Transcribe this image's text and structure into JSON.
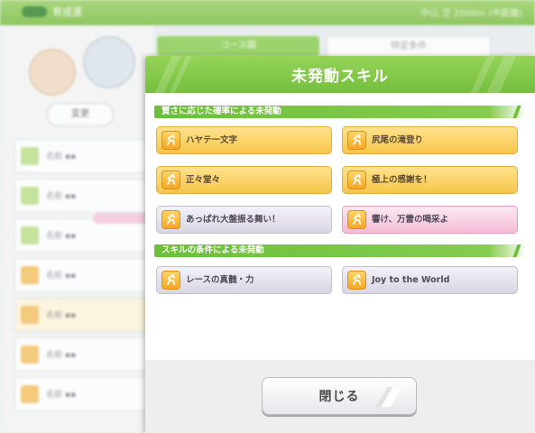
{
  "background": {
    "topbar_title": "育成選",
    "topbar_right": "中山 芝 2000m (中距離)",
    "tab_left": "コース図",
    "tab_right": "特定条件",
    "oval_label": "変更",
    "rows": [
      "名前 ▪▪",
      "名前 ▪▪",
      "名前 ▪▪",
      "名前 ▪▪",
      "名前 ▪▪",
      "名前 ▪▪",
      "名前 ▪▪"
    ]
  },
  "modal": {
    "title": "未発動スキル",
    "sections": [
      {
        "label": "賢さに応じた確率による未発動",
        "skills": [
          {
            "name": "ハヤテ一文字",
            "style": "gold"
          },
          {
            "name": "尻尾の滝登り",
            "style": "gold"
          },
          {
            "name": "正々堂々",
            "style": "gold"
          },
          {
            "name": "極上の感謝を！",
            "style": "gold"
          },
          {
            "name": "あっぱれ大盤振る舞い！",
            "style": "gray"
          },
          {
            "name": "響け、万雷の喝采よ",
            "style": "pink"
          }
        ]
      },
      {
        "label": "スキルの条件による未発動",
        "skills": [
          {
            "name": "レースの真髄・力",
            "style": "gray"
          },
          {
            "name": "Joy to the World",
            "style": "gray"
          }
        ]
      }
    ],
    "close_label": "閉じる"
  },
  "icons": {
    "skill": "skill-runner-icon"
  },
  "colors": {
    "header_green": "#86cc4f",
    "skill_gold": "#f7c54a",
    "skill_gray": "#d9d6e4",
    "skill_pink": "#f3bcd6"
  }
}
